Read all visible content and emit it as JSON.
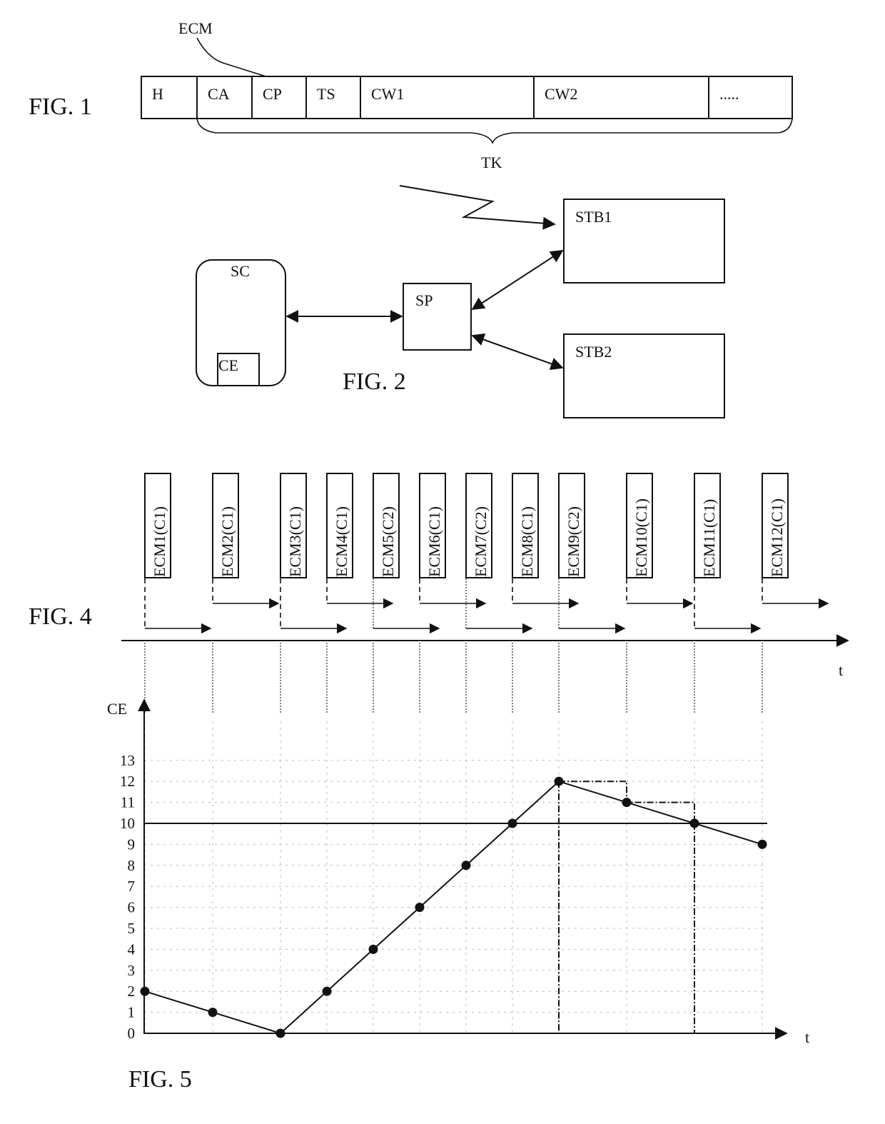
{
  "fig1": {
    "label": "FIG. 1",
    "ecm_label": "ECM",
    "tk_label": "TK",
    "cells": [
      "H",
      "CA",
      "CP",
      "TS",
      "CW1",
      "CW2",
      "....."
    ]
  },
  "fig2": {
    "label": "FIG. 2",
    "sc": "SC",
    "ce": "CE",
    "sp": "SP",
    "stb1": "STB1",
    "stb2": "STB2"
  },
  "fig4": {
    "label": "FIG. 4",
    "time_label": "t",
    "messages": [
      {
        "id": "ECM1(C1)",
        "channel": "C1",
        "arrow_row": "lower"
      },
      {
        "id": "ECM2(C1)",
        "channel": "C1",
        "arrow_row": "upper"
      },
      {
        "id": "ECM3(C1)",
        "channel": "C1",
        "arrow_row": "lower"
      },
      {
        "id": "ECM4(C1)",
        "channel": "C1",
        "arrow_row": "upper"
      },
      {
        "id": "ECM5(C2)",
        "channel": "C2",
        "arrow_row": "lower"
      },
      {
        "id": "ECM6(C1)",
        "channel": "C1",
        "arrow_row": "upper"
      },
      {
        "id": "ECM7(C2)",
        "channel": "C2",
        "arrow_row": "lower"
      },
      {
        "id": "ECM8(C1)",
        "channel": "C1",
        "arrow_row": "upper"
      },
      {
        "id": "ECM9(C2)",
        "channel": "C2",
        "arrow_row": "lower"
      },
      {
        "id": "ECM10(C1)",
        "channel": "C1",
        "arrow_row": "upper"
      },
      {
        "id": "ECM11(C1)",
        "channel": "C1",
        "arrow_row": "lower"
      },
      {
        "id": "ECM12(C1)",
        "channel": "C1",
        "arrow_row": "upper"
      }
    ]
  },
  "fig5": {
    "label": "FIG. 5"
  },
  "chart_data": {
    "type": "line",
    "title": "FIG. 5",
    "xlabel": "t",
    "ylabel": "CE",
    "categories": [
      "ECM1",
      "ECM2",
      "ECM3",
      "ECM4",
      "ECM5",
      "ECM6",
      "ECM7",
      "ECM8",
      "ECM9",
      "ECM10",
      "ECM11",
      "ECM12"
    ],
    "series": [
      {
        "name": "CE",
        "values": [
          2,
          1,
          0,
          2,
          4,
          6,
          8,
          10,
          12,
          11,
          10,
          9
        ]
      }
    ],
    "threshold": 10,
    "yticks": [
      0,
      1,
      2,
      3,
      4,
      5,
      6,
      7,
      8,
      9,
      10,
      11,
      12,
      13
    ],
    "ylim": [
      0,
      13
    ],
    "grid": true,
    "step_overlay": {
      "description": "dash-dot step from ECM9 peak",
      "values": [
        12,
        11,
        10
      ]
    }
  }
}
